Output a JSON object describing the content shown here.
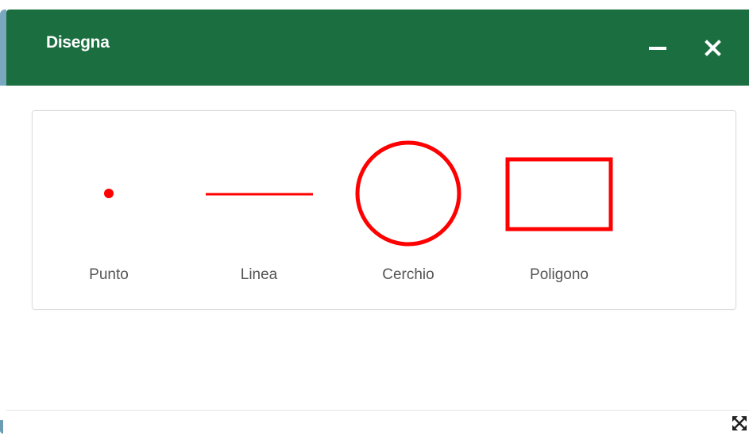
{
  "window": {
    "title": "Disegna",
    "header_color": "#1b6e3f",
    "controls": {
      "minimize_icon": "minimize-icon",
      "close_icon": "close-icon",
      "expand_icon": "expand-icon"
    }
  },
  "tools": [
    {
      "label": "Punto",
      "icon": "point-icon"
    },
    {
      "label": "Linea",
      "icon": "line-icon"
    },
    {
      "label": "Cerchio",
      "icon": "circle-icon"
    },
    {
      "label": "Poligono",
      "icon": "polygon-icon"
    }
  ],
  "colors": {
    "accent": "#ff0000",
    "label": "#555555"
  }
}
